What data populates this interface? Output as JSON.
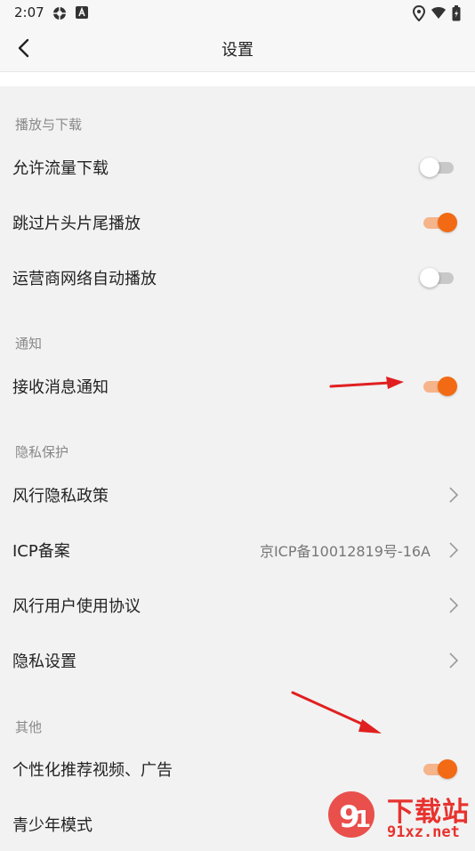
{
  "status_bar": {
    "time": "2:07",
    "icons": [
      "settings-gear-icon",
      "a-badge-icon",
      "location-pin-icon",
      "wifi-icon",
      "battery-icon"
    ]
  },
  "header": {
    "title": "设置",
    "back_icon": "chevron-left-icon"
  },
  "sections": [
    {
      "label": "播放与下载",
      "items": [
        {
          "label": "允许流量下载",
          "control": "toggle",
          "on": false
        },
        {
          "label": "跳过片头片尾播放",
          "control": "toggle",
          "on": true
        },
        {
          "label": "运营商网络自动播放",
          "control": "toggle",
          "on": false
        }
      ]
    },
    {
      "label": "通知",
      "items": [
        {
          "label": "接收消息通知",
          "control": "toggle",
          "on": true
        }
      ]
    },
    {
      "label": "隐私保护",
      "items": [
        {
          "label": "风行隐私政策",
          "control": "chevron"
        },
        {
          "label": "ICP备案",
          "value": "京ICP备10012819号-16A",
          "control": "chevron"
        },
        {
          "label": "风行用户使用协议",
          "control": "chevron"
        },
        {
          "label": "隐私设置",
          "control": "chevron"
        }
      ]
    },
    {
      "label": "其他",
      "items": [
        {
          "label": "个性化推荐视频、广告",
          "control": "toggle",
          "on": true
        },
        {
          "label": "青少年模式"
        }
      ]
    }
  ],
  "colors": {
    "accent": "#f26a14",
    "accent_track": "#f5b48a",
    "annotation_arrow": "#e02020"
  },
  "watermark": {
    "line1": "下载站",
    "line2": "91xz.net"
  }
}
